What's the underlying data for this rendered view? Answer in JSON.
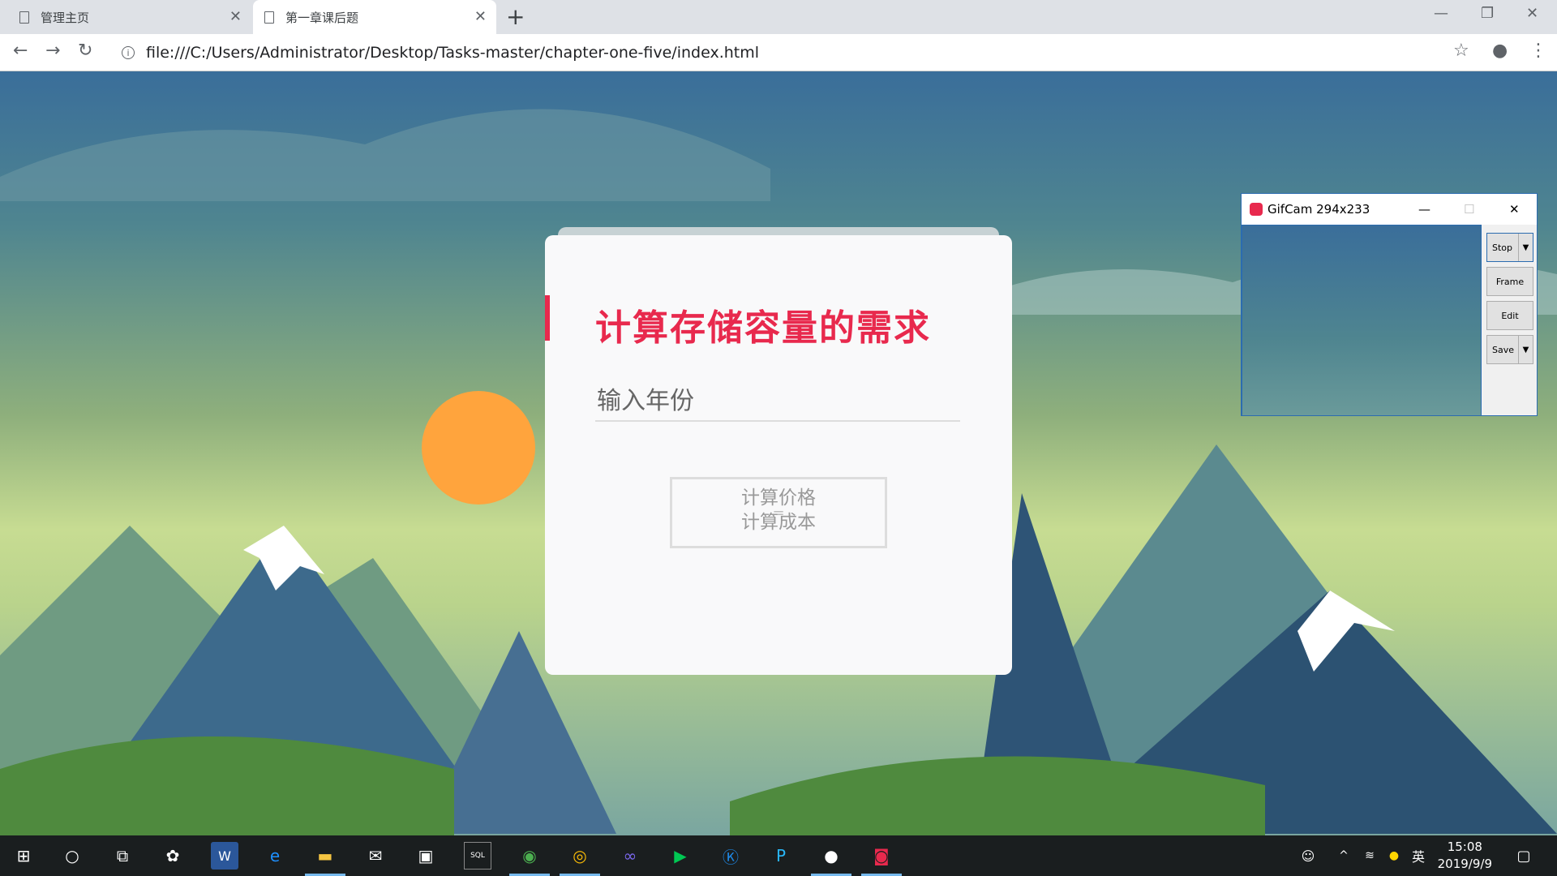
{
  "browser": {
    "tabs": [
      {
        "title": "管理主页",
        "active": false
      },
      {
        "title": "第一章课后题",
        "active": true
      }
    ],
    "url": "file:///C:/Users/Administrator/Desktop/Tasks-master/chapter-one-five/index.html"
  },
  "card": {
    "title": "计算存储容量的需求",
    "year_placeholder": "输入年份",
    "result": "=",
    "links": [
      "计算价格",
      "计算成本"
    ]
  },
  "gifcam": {
    "title": "GifCam 294x233",
    "buttons": [
      "Stop",
      "Frame",
      "Edit",
      "Save"
    ]
  },
  "taskbar": {
    "ime": "英",
    "time": "15:08",
    "date": "2019/9/9"
  },
  "colors": {
    "accent": "#e8294d",
    "sun": "#ffa43d"
  }
}
